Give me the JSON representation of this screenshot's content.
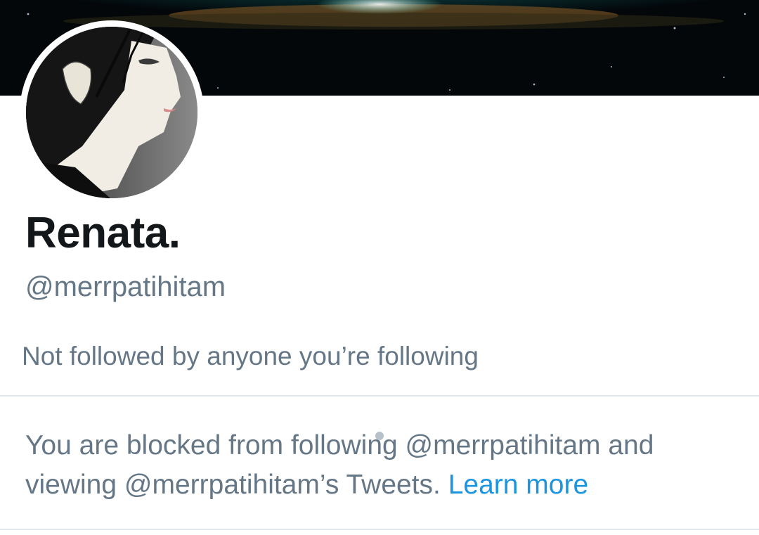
{
  "profile": {
    "display_name": "Renata.",
    "handle": "@merrpatihitam",
    "followers_info": "Not followed by anyone you’re following"
  },
  "blocked_notice": {
    "line1": "You are blocked from following @merrpatihitam and",
    "line2": "viewing @merrpatihitam’s Tweets.",
    "learn_more_label": "Learn more"
  },
  "colors": {
    "primary_text": "#14171a",
    "secondary_text": "#657786",
    "link": "#1b95e0",
    "divider": "#e1e8ed"
  },
  "icons": {
    "banner": "galaxy-header-image",
    "avatar": "anime-portrait-avatar"
  }
}
